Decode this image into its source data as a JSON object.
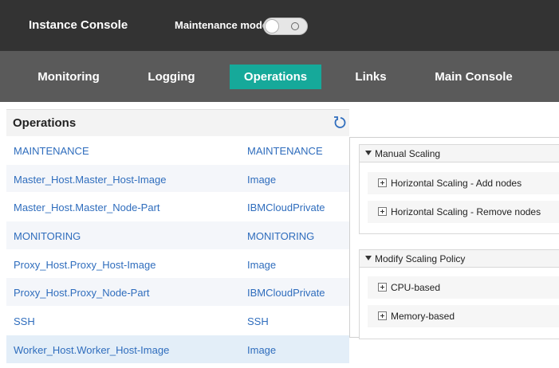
{
  "header": {
    "title": "Instance Console",
    "maintenance_label": "Maintenance mode"
  },
  "nav": {
    "tabs": [
      {
        "label": "Monitoring"
      },
      {
        "label": "Logging"
      },
      {
        "label": "Operations",
        "active": true
      },
      {
        "label": "Links"
      },
      {
        "label": "Main Console"
      }
    ]
  },
  "operations": {
    "title": "Operations",
    "rows": [
      {
        "name": "MAINTENANCE",
        "type": "MAINTENANCE"
      },
      {
        "name": "Master_Host.Master_Host-Image",
        "type": "Image"
      },
      {
        "name": "Master_Host.Master_Node-Part",
        "type": "IBMCloudPrivate"
      },
      {
        "name": "MONITORING",
        "type": "MONITORING"
      },
      {
        "name": "Proxy_Host.Proxy_Host-Image",
        "type": "Image"
      },
      {
        "name": "Proxy_Host.Proxy_Node-Part",
        "type": "IBMCloudPrivate"
      },
      {
        "name": "SSH",
        "type": "SSH"
      },
      {
        "name": "Worker_Host.Worker_Host-Image",
        "type": "Image",
        "selected": true
      }
    ]
  },
  "details": {
    "sections": [
      {
        "title": "Manual Scaling",
        "items": [
          {
            "label": "Horizontal Scaling - Add nodes"
          },
          {
            "label": "Horizontal Scaling - Remove nodes"
          }
        ]
      },
      {
        "title": "Modify Scaling Policy",
        "items": [
          {
            "label": "CPU-based"
          },
          {
            "label": "Memory-based"
          }
        ]
      }
    ]
  },
  "colors": {
    "topbar": "#333333",
    "navbar": "#5a5a5a",
    "active_tab": "#16a99a",
    "link": "#2f6dbd"
  }
}
